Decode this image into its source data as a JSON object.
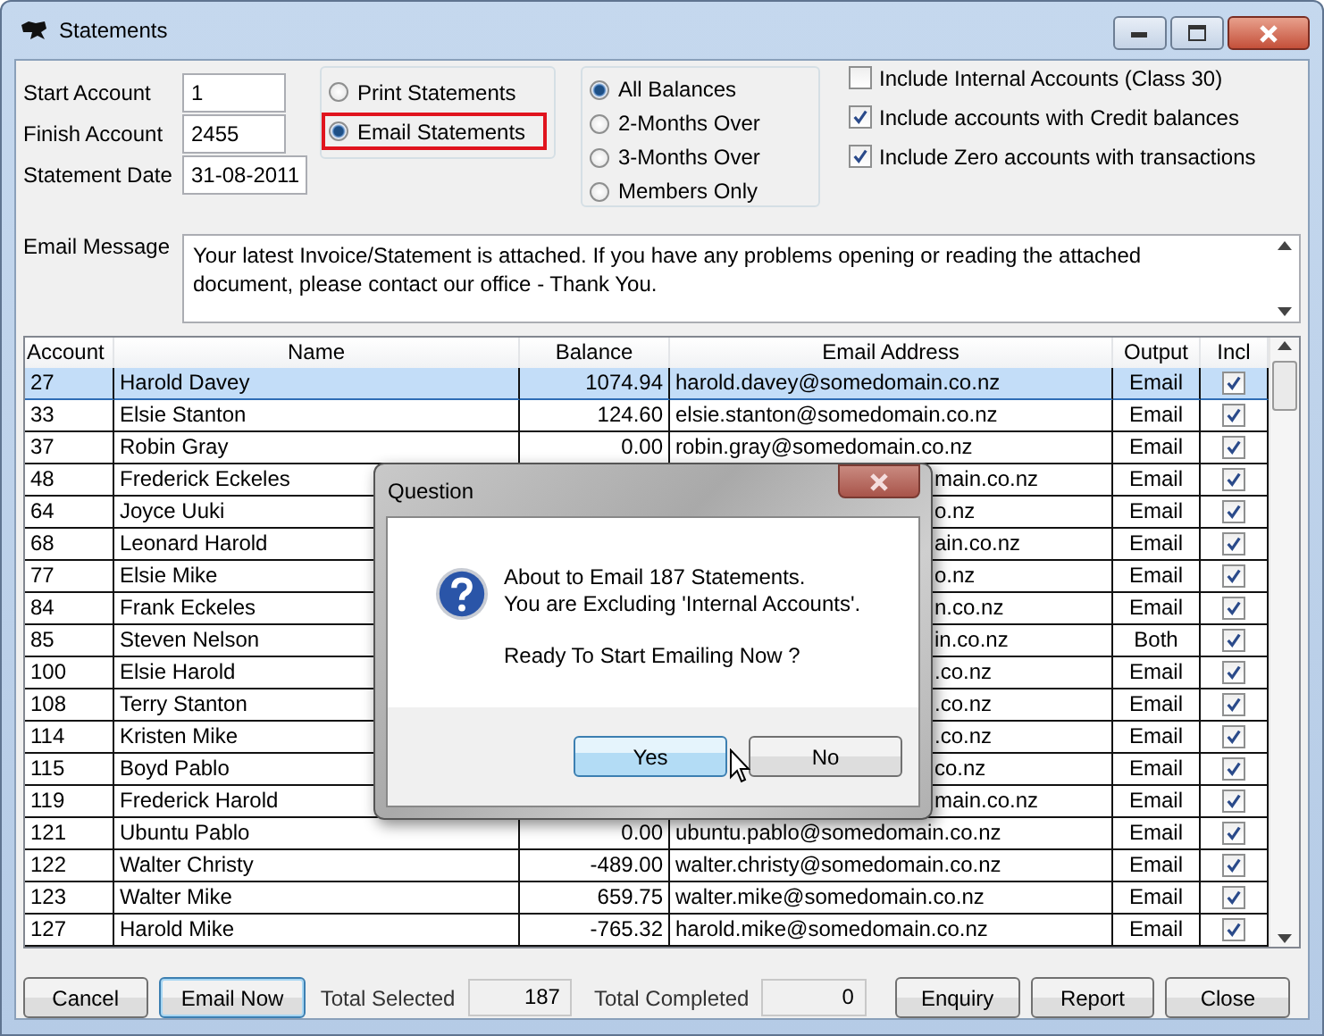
{
  "window": {
    "title": "Statements"
  },
  "fields": [
    {
      "label": "Start Account",
      "value": "1"
    },
    {
      "label": "Finish Account",
      "value": "2455"
    },
    {
      "label": "Statement Date",
      "value": "31-08-2011"
    }
  ],
  "statement_type": [
    {
      "label": "Print Statements",
      "selected": false,
      "highlighted": false
    },
    {
      "label": "Email Statements",
      "selected": true,
      "highlighted": true
    }
  ],
  "balance_filter": [
    {
      "label": "All Balances",
      "selected": true
    },
    {
      "label": "2-Months Over",
      "selected": false
    },
    {
      "label": "3-Months Over",
      "selected": false
    },
    {
      "label": "Members Only",
      "selected": false
    }
  ],
  "options": [
    {
      "label": "Include Internal Accounts (Class 30)",
      "checked": false
    },
    {
      "label": "Include accounts with Credit balances",
      "checked": true
    },
    {
      "label": "Include Zero accounts with transactions",
      "checked": true
    }
  ],
  "email_message": {
    "label": "Email Message",
    "value": "Your latest Invoice/Statement is attached. If you have any problems opening or reading the attached document, please contact our office - Thank You."
  },
  "table": {
    "columns": [
      "Account",
      "Name",
      "Balance",
      "Email Address",
      "Output",
      "Incl"
    ],
    "rows": [
      {
        "account": "27",
        "name": "Harold Davey",
        "balance": "1074.94",
        "email": "harold.davey@somedomain.co.nz",
        "output": "Email",
        "incl": true,
        "selected": true
      },
      {
        "account": "33",
        "name": "Elsie Stanton",
        "balance": "124.60",
        "email": "elsie.stanton@somedomain.co.nz",
        "output": "Email",
        "incl": true,
        "selected": false
      },
      {
        "account": "37",
        "name": "Robin Gray",
        "balance": "0.00",
        "email": "robin.gray@somedomain.co.nz",
        "output": "Email",
        "incl": true,
        "selected": false
      },
      {
        "account": "48",
        "name": "Frederick Eckeles",
        "email": "main.co.nz",
        "output": "Email",
        "incl": true,
        "selected": false
      },
      {
        "account": "64",
        "name": "Joyce Uuki",
        "email": "o.nz",
        "output": "Email",
        "incl": true,
        "selected": false
      },
      {
        "account": "68",
        "name": "Leonard Harold",
        "email": "ain.co.nz",
        "output": "Email",
        "incl": true,
        "selected": false
      },
      {
        "account": "77",
        "name": "Elsie Mike",
        "email": "o.nz",
        "output": "Email",
        "incl": true,
        "selected": false
      },
      {
        "account": "84",
        "name": "Frank Eckeles",
        "email": "n.co.nz",
        "output": "Email",
        "incl": true,
        "selected": false
      },
      {
        "account": "85",
        "name": "Steven Nelson",
        "email": "in.co.nz",
        "output": "Both",
        "incl": true,
        "selected": false
      },
      {
        "account": "100",
        "name": "Elsie Harold",
        "email": ".co.nz",
        "output": "Email",
        "incl": true,
        "selected": false
      },
      {
        "account": "108",
        "name": "Terry Stanton",
        "email": ".co.nz",
        "output": "Email",
        "incl": true,
        "selected": false
      },
      {
        "account": "114",
        "name": "Kristen Mike",
        "email": ".co.nz",
        "output": "Email",
        "incl": true,
        "selected": false
      },
      {
        "account": "115",
        "name": "Boyd Pablo",
        "email": "co.nz",
        "output": "Email",
        "incl": true,
        "selected": false
      },
      {
        "account": "119",
        "name": "Frederick Harold",
        "email": "main.co.nz",
        "output": "Email",
        "incl": true,
        "selected": false
      },
      {
        "account": "121",
        "name": "Ubuntu Pablo",
        "balance": "0.00",
        "email": "ubuntu.pablo@somedomain.co.nz",
        "output": "Email",
        "incl": true,
        "selected": false
      },
      {
        "account": "122",
        "name": "Walter Christy",
        "balance": "-489.00",
        "email": "walter.christy@somedomain.co.nz",
        "output": "Email",
        "incl": true,
        "selected": false
      },
      {
        "account": "123",
        "name": "Walter Mike",
        "balance": "659.75",
        "email": "walter.mike@somedomain.co.nz",
        "output": "Email",
        "incl": true,
        "selected": false
      },
      {
        "account": "127",
        "name": "Harold Mike",
        "balance": "-765.32",
        "email": "harold.mike@somedomain.co.nz",
        "output": "Email",
        "incl": true,
        "selected": false
      }
    ]
  },
  "footer": {
    "left_buttons": [
      {
        "label": "Cancel",
        "focused": false
      },
      {
        "label": "Email Now",
        "focused": true
      }
    ],
    "totals": [
      {
        "label": "Total Selected",
        "value": "187"
      },
      {
        "label": "Total Completed",
        "value": "0"
      }
    ],
    "right_buttons": [
      {
        "label": "Enquiry",
        "focused": false
      },
      {
        "label": "Report",
        "focused": false
      },
      {
        "label": "Close",
        "focused": false
      }
    ]
  },
  "dialog": {
    "title": "Question",
    "paragraphs": [
      "About to Email 187 Statements.\nYou are Excluding 'Internal Accounts'.",
      "Ready To Start Emailing Now ?"
    ],
    "buttons": [
      {
        "label": "Yes",
        "focused": true
      },
      {
        "label": "No",
        "focused": false
      }
    ]
  }
}
